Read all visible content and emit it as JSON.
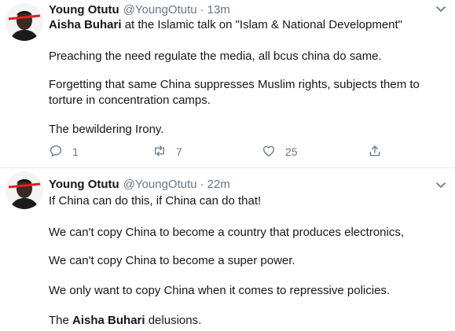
{
  "tweets": [
    {
      "name": "Young Otutu",
      "handle": "@YoungOtutu",
      "time": "13m",
      "line1_bold": "Aisha Buhari",
      "line1_rest": " at the Islamic talk on \"Islam & National Development\"",
      "line2": "Preaching the need regulate the media, all bcus china do same.",
      "line3a": "Forgetting that same China  suppresses Muslim rights, subjects them to",
      "line3b": "torture in concentration camps.",
      "line4": "The bewildering Irony.",
      "replies": "1",
      "retweets": "7",
      "likes": "25"
    },
    {
      "name": "Young Otutu",
      "handle": "@YoungOtutu",
      "time": "22m",
      "line1": "If China can do this, if China can do that!",
      "line2": "We can't copy China to become a country that produces electronics,",
      "line3": "We can't copy China to become a super power.",
      "line4": "We only want to copy China when it comes to repressive policies.",
      "line5_pre": "The ",
      "line5_bold": "Aisha Buhari",
      "line5_post": " delusions."
    }
  ],
  "separator": "·",
  "icons": {
    "more": "chevron-down-icon",
    "reply": "reply-icon",
    "retweet": "retweet-icon",
    "like": "heart-icon",
    "share": "share-icon"
  },
  "colors": {
    "muted": "#657786",
    "text": "#14171a",
    "divider": "#e6ecf0"
  }
}
